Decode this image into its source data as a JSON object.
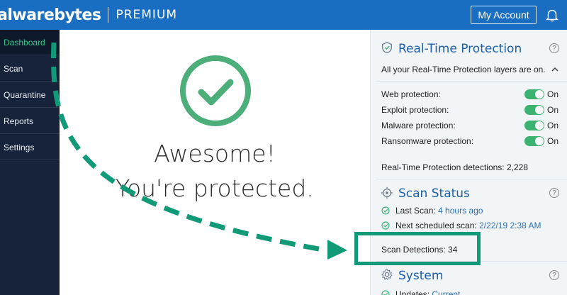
{
  "app": {
    "brand": "alwarebytes",
    "tier": "PREMIUM",
    "account_label": "My Account"
  },
  "sidebar": {
    "items": [
      {
        "label": "Dashboard",
        "active": true
      },
      {
        "label": "Scan"
      },
      {
        "label": "Quarantine"
      },
      {
        "label": "Reports"
      },
      {
        "label": "Settings"
      }
    ]
  },
  "main": {
    "headline_1": "Awesome!",
    "headline_2": "You're protected."
  },
  "rtp": {
    "title": "Real-Time Protection",
    "summary": "All your Real-Time Protection layers are on.",
    "layers": [
      {
        "label": "Web protection:",
        "state": "On"
      },
      {
        "label": "Exploit protection:",
        "state": "On"
      },
      {
        "label": "Malware protection:",
        "state": "On"
      },
      {
        "label": "Ransomware protection:",
        "state": "On"
      }
    ],
    "detections": "Real-Time Protection detections: 2,228"
  },
  "scan": {
    "title": "Scan Status",
    "last_label": "Last Scan:",
    "last_value": "4 hours ago",
    "next_label": "Next scheduled scan:",
    "next_value": "2/22/19 2:38 AM",
    "detections": "Scan Detections: 34"
  },
  "system": {
    "title": "System",
    "updates_label": "Updates:",
    "updates_value": "Current"
  },
  "help_glyph": "?",
  "colors": {
    "header": "#1a6ec2",
    "sidebar": "#16233a",
    "accent_green": "#3cb371",
    "annotation": "#119a77",
    "title_blue": "#1c5ea8"
  }
}
